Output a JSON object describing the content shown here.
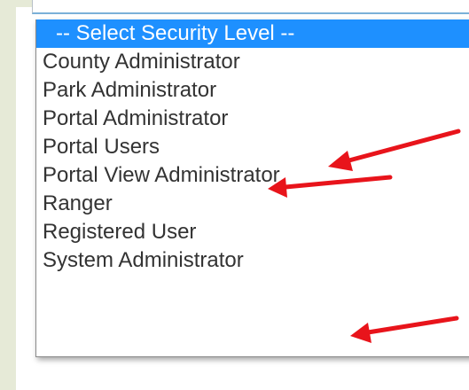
{
  "dropdown": {
    "options": [
      "-- Select Security Level --",
      "County Administrator",
      "Park Administrator",
      "Portal Administrator",
      "Portal Users",
      "Portal View Administrator",
      "Ranger",
      "Registered User",
      "System Administrator"
    ],
    "selected_index": 0
  },
  "colors": {
    "highlight": "#1e90ff",
    "arrow": "#e8141b",
    "background": "#e6ead7"
  },
  "annotations": {
    "arrows_point_to": [
      "Portal Administrator",
      "Portal Users",
      "System Administrator"
    ]
  }
}
